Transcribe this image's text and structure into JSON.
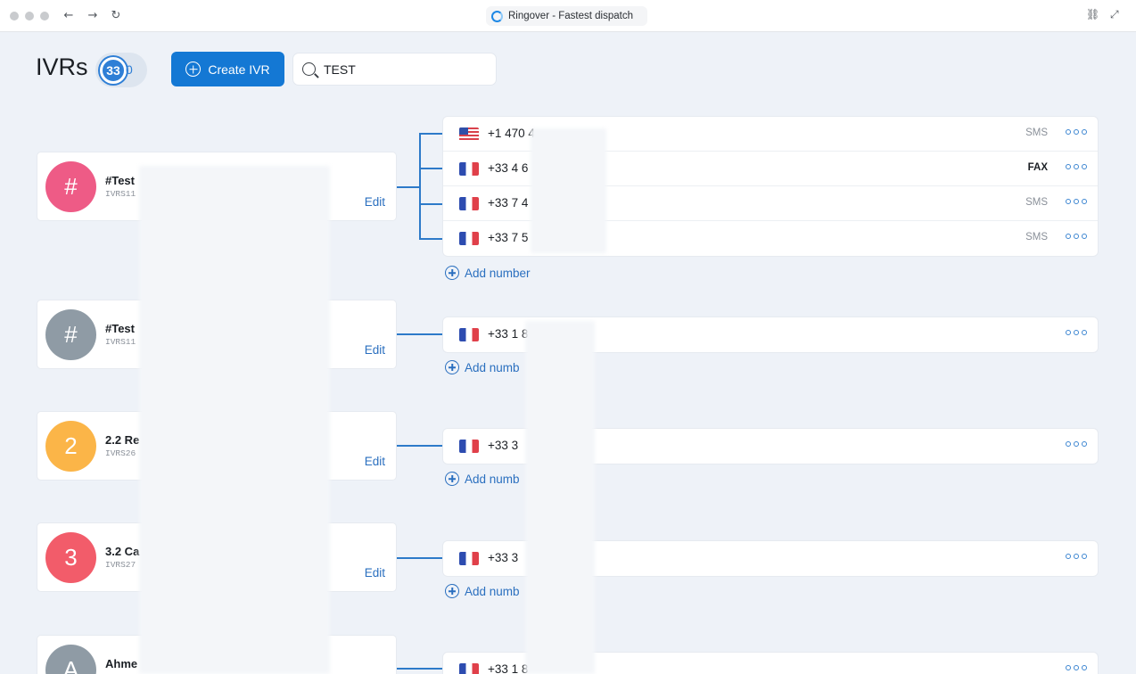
{
  "browser": {
    "tab_title": "Ringover - Fastest dispatch",
    "back": "←",
    "forward": "→",
    "reload": "↻",
    "link": "⛓",
    "expand": "⤢"
  },
  "header": {
    "title": "IVRs",
    "count_badge": "33",
    "count_tail": "0",
    "create_label": "Create IVR",
    "search_value": "TEST"
  },
  "add_number_label": "Add number",
  "add_number_truncated": "Add numb",
  "ivrs": [
    {
      "avatar": "#",
      "avatar_color": "#ee5b86",
      "name": "#Test",
      "id": "IVRS11",
      "edit": "Edit",
      "numbers": [
        {
          "flag": "us",
          "text": "+1 470 4",
          "tag": "SMS"
        },
        {
          "flag": "fr",
          "text": "+33 4 6",
          "tag": "FAX"
        },
        {
          "flag": "fr",
          "text": "+33 7 4",
          "tag": "SMS"
        },
        {
          "flag": "fr",
          "text": "+33 7 5",
          "tag": "SMS"
        }
      ]
    },
    {
      "avatar": "#",
      "avatar_color": "#8f9ba5",
      "name": "#Test",
      "id": "IVRS11",
      "edit": "Edit",
      "numbers": [
        {
          "flag": "fr",
          "text": "+33 1 8",
          "tag": ""
        }
      ]
    },
    {
      "avatar": "2",
      "avatar_color": "#fbb548",
      "name": "2.2 Re",
      "id": "IVRS26",
      "edit": "Edit",
      "numbers": [
        {
          "flag": "fr",
          "text": "+33 3",
          "tag": ""
        }
      ]
    },
    {
      "avatar": "3",
      "avatar_color": "#f25c6a",
      "name": "3.2 Ca",
      "id": "IVRS27",
      "edit": "Edit",
      "numbers": [
        {
          "flag": "fr",
          "text": "+33 3",
          "tag": ""
        }
      ]
    },
    {
      "avatar": "A",
      "avatar_color": "#8f9ba5",
      "name": "Ahme",
      "id": "",
      "edit": "",
      "numbers": [
        {
          "flag": "fr",
          "text": "+33 1 8",
          "tag": ""
        }
      ]
    }
  ]
}
